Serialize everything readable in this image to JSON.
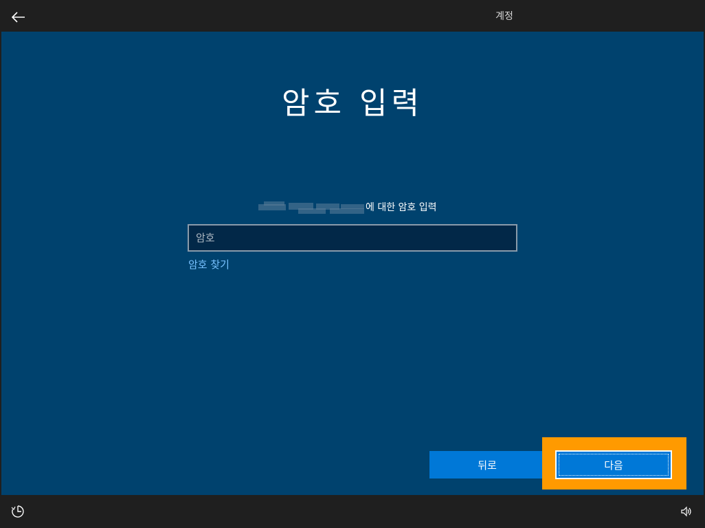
{
  "header": {
    "tab_label": "계정"
  },
  "main": {
    "title": "암호 입력",
    "description_suffix": "에 대한 암호 입력",
    "password_placeholder": "암호",
    "password_value": "",
    "find_password_link": "암호 찾기"
  },
  "buttons": {
    "back_label": "뒤로",
    "next_label": "다음"
  },
  "icons": {
    "back": "back-arrow-icon",
    "ease_of_access": "ease-of-access-icon",
    "volume": "volume-icon"
  },
  "colors": {
    "background": "#00426e",
    "accent": "#0078d7",
    "highlight": "#ff9a00",
    "link": "#78c1ff"
  }
}
